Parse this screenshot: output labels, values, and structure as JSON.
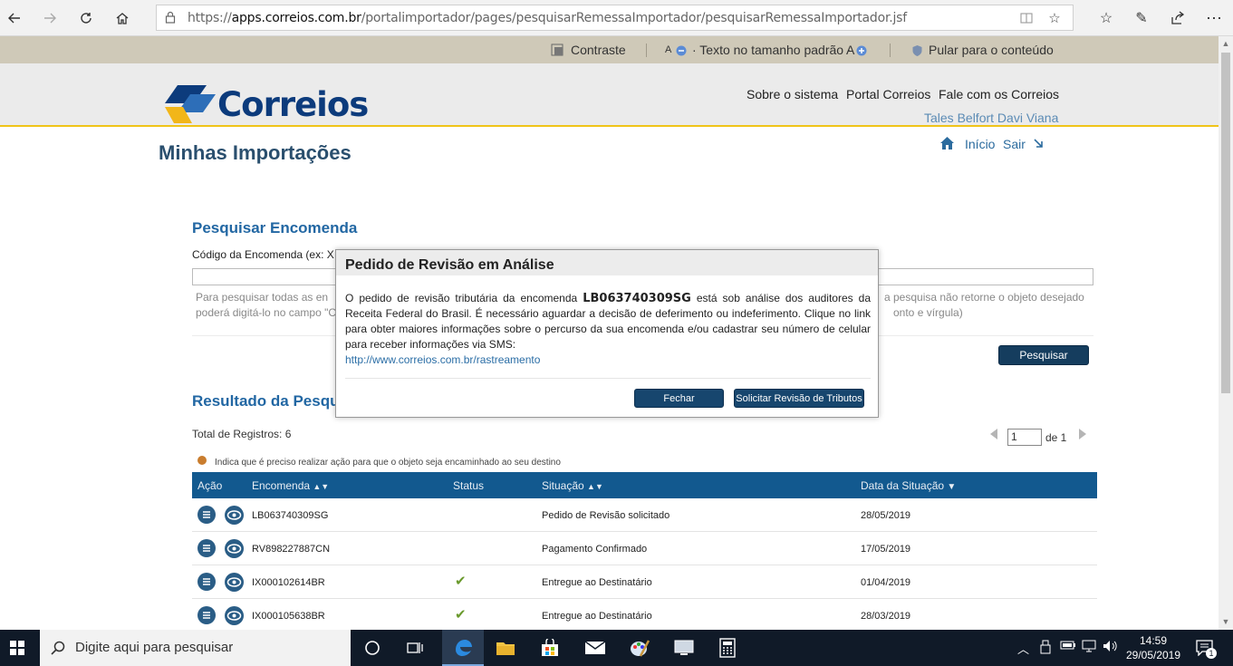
{
  "browser": {
    "url_prefix": "https://",
    "url_host": "apps.correios.com.br",
    "url_path": "/portalimportador/pages/pesquisarRemessaImportador/pesquisarRemessaImportador.jsf"
  },
  "accessibility": {
    "contrast": "Contraste",
    "font_small": "A",
    "font_default": "· Texto no tamanho padrão ·",
    "font_large": "A",
    "skip": "Pular para o conteúdo"
  },
  "header": {
    "logo_text": "Correios",
    "nav": [
      "Sobre o sistema",
      "Portal Correios",
      "Fale com os Correios"
    ],
    "username": "Tales Belfort Davi Viana",
    "home": "Início",
    "logout": "Sair"
  },
  "page_title": "Minhas Importações",
  "search": {
    "title": "Pesquisar Encomenda",
    "label": "Código da Encomenda (ex: X",
    "help_line1": "Para pesquisar todas as en",
    "help_line1_right": "a pesquisa não retorne o objeto desejado",
    "help_line2": "poderá digitá-lo no campo \"C",
    "help_line2_right": "onto e vírgula)",
    "button": "Pesquisar"
  },
  "results": {
    "title": "Resultado da Pesqui",
    "total": "Total de Registros: 6",
    "page_current": "1",
    "page_of": "de 1",
    "legend": "Indica que é preciso realizar ação para que o objeto seja encaminhado ao seu destino",
    "columns": [
      "Ação",
      "Encomenda",
      "Status",
      "Situação",
      "Data da Situação"
    ],
    "rows": [
      {
        "code": "LB063740309SG",
        "situation": "Pedido de Revisão solicitado",
        "date": "28/05/2019",
        "delivered": false
      },
      {
        "code": "RV898227887CN",
        "situation": "Pagamento Confirmado",
        "date": "17/05/2019",
        "delivered": false
      },
      {
        "code": "IX000102614BR",
        "situation": "Entregue ao Destinatário",
        "date": "01/04/2019",
        "delivered": true
      },
      {
        "code": "IX000105638BR",
        "situation": "Entregue ao Destinatário",
        "date": "28/03/2019",
        "delivered": true
      }
    ]
  },
  "modal": {
    "title": "Pedido de Revisão em Análise",
    "text_before": "O pedido de revisão tributária da encomenda ",
    "code": "LB063740309SG",
    "text_after": " está sob análise dos auditores da Receita Federal do Brasil. É necessário aguardar a decisão de deferimento ou indeferimento. Clique no link para obter maiores informações sobre o percurso da sua encomenda e/ou cadastrar seu número de celular para receber informações via SMS:",
    "link": "http://www.correios.com.br/rastreamento",
    "close_button": "Fechar",
    "review_button": "Solicitar Revisão de Tributos"
  },
  "taskbar": {
    "search_placeholder": "Digite aqui para pesquisar",
    "time": "14:59",
    "date": "29/05/2019",
    "notification_count": "1"
  },
  "colors": {
    "brand_blue": "#0c3b7c",
    "accent_yellow": "#f0c419",
    "table_header": "#12598f",
    "button_dark": "#153d5e"
  }
}
